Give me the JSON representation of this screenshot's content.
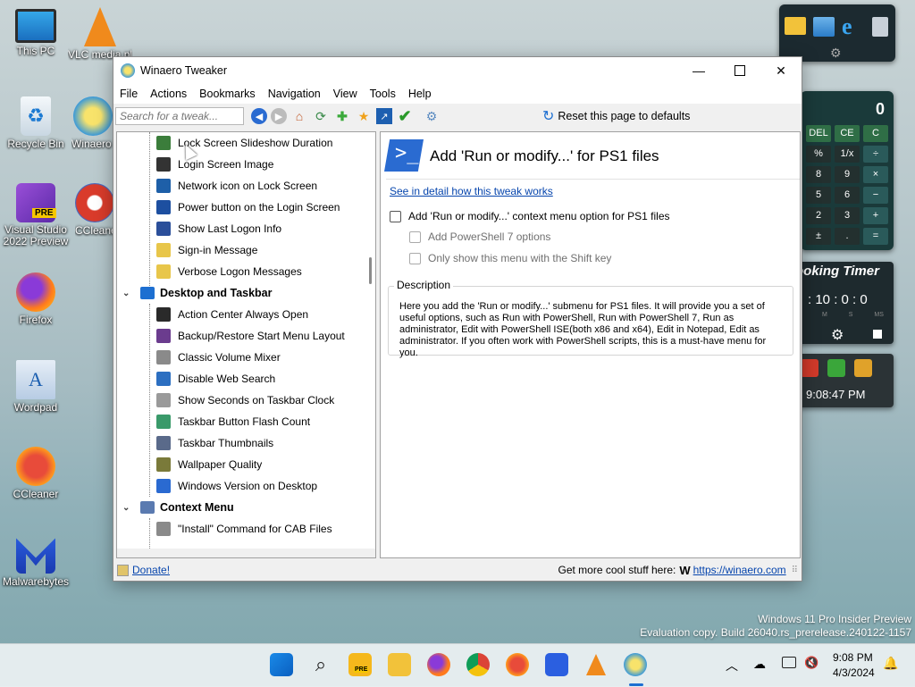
{
  "desktop": {
    "icons": [
      {
        "label": "This PC"
      },
      {
        "label": "VLC media player"
      },
      {
        "label": "Recycle Bin"
      },
      {
        "label": "Winaero Tweaker"
      },
      {
        "label": "Visual Studio 2022 Preview"
      },
      {
        "label": "CCleaner Browser"
      },
      {
        "label": "Firefox"
      },
      {
        "label": "Wordpad"
      },
      {
        "label": "CCleaner"
      },
      {
        "label": "Malwarebytes"
      }
    ],
    "pre_badge": "PRE",
    "calculator": {
      "display": "0",
      "keys": [
        "DEL",
        "CE",
        "C",
        "%",
        "1/x",
        "÷",
        "8",
        "9",
        "×",
        "5",
        "6",
        "−",
        "2",
        "3",
        "+",
        "±",
        ".",
        "="
      ]
    },
    "timer": {
      "title": "ooking Timer",
      "hours": "10",
      "minutes": "0",
      "seconds": "0",
      "labels": [
        "M",
        "S",
        "MS"
      ]
    },
    "clock_gadget": {
      "time": "9:08:47 PM"
    },
    "watermark": {
      "line1": "Windows 11 Pro Insider Preview",
      "line2": "Evaluation copy. Build 26040.rs_prerelease.240122-1157"
    }
  },
  "window": {
    "title": "Winaero Tweaker",
    "menu": [
      "File",
      "Actions",
      "Bookmarks",
      "Navigation",
      "View",
      "Tools",
      "Help"
    ],
    "search_placeholder": "Search for a tweak...",
    "reset_label": "Reset this page to defaults",
    "tree": [
      {
        "type": "leaf",
        "label": "Lock Screen Slideshow Duration",
        "color": "#3b7d3b"
      },
      {
        "type": "leaf",
        "label": "Login Screen Image",
        "color": "#333333"
      },
      {
        "type": "leaf",
        "label": "Network icon on Lock Screen",
        "color": "#1e5fa8"
      },
      {
        "type": "leaf",
        "label": "Power button on the Login Screen",
        "color": "#1d4fa0"
      },
      {
        "type": "leaf",
        "label": "Show Last Logon Info",
        "color": "#2b4f9a"
      },
      {
        "type": "leaf",
        "label": "Sign-in Message",
        "color": "#e8c64a"
      },
      {
        "type": "leaf",
        "label": "Verbose Logon Messages",
        "color": "#e8c64a"
      },
      {
        "type": "cat",
        "label": "Desktop and Taskbar",
        "color": "#1d6fd1"
      },
      {
        "type": "leaf",
        "label": "Action Center Always Open",
        "color": "#2a2a2a"
      },
      {
        "type": "leaf",
        "label": "Backup/Restore Start Menu Layout",
        "color": "#6b3c8e"
      },
      {
        "type": "leaf",
        "label": "Classic Volume Mixer",
        "color": "#8a8a8a"
      },
      {
        "type": "leaf",
        "label": "Disable Web Search",
        "color": "#2c6fc1"
      },
      {
        "type": "leaf",
        "label": "Show Seconds on Taskbar Clock",
        "color": "#9a9a9a"
      },
      {
        "type": "leaf",
        "label": "Taskbar Button Flash Count",
        "color": "#3a9a6a"
      },
      {
        "type": "leaf",
        "label": "Taskbar Thumbnails",
        "color": "#5a6a8a"
      },
      {
        "type": "leaf",
        "label": "Wallpaper Quality",
        "color": "#7a7a3a"
      },
      {
        "type": "leaf",
        "label": "Windows Version on Desktop",
        "color": "#2a6ad1"
      },
      {
        "type": "cat",
        "label": "Context Menu",
        "color": "#5a7ab0"
      },
      {
        "type": "leaf",
        "label": "\"Install\" Command for CAB Files",
        "color": "#8a8a8a"
      }
    ],
    "detail": {
      "heading": "Add 'Run or modify...' for PS1 files",
      "link": "See in detail how this tweak works",
      "option_main": "Add 'Run or modify...' context menu option for PS1 files",
      "option_ps7": "Add PowerShell 7 options",
      "option_shift": "Only show this menu with the Shift key",
      "description_label": "Description",
      "description": "Here you add the 'Run or modify...' submenu for PS1 files. It will provide you a set of useful options, such as Run with PowerShell, Run with PowerShell 7, Run as administrator, Edit with PowerShell ISE(both x86 and x64), Edit in Notepad, Edit as administrator. If you often work with PowerShell scripts, this is a must-have menu for you."
    },
    "status": {
      "donate": "Donate!",
      "more": "Get more cool stuff here:",
      "logo": "W",
      "url": "https://winaero.com"
    }
  },
  "taskbar": {
    "pre_badge": "PRE",
    "time": "9:08 PM",
    "date": "4/3/2024"
  }
}
